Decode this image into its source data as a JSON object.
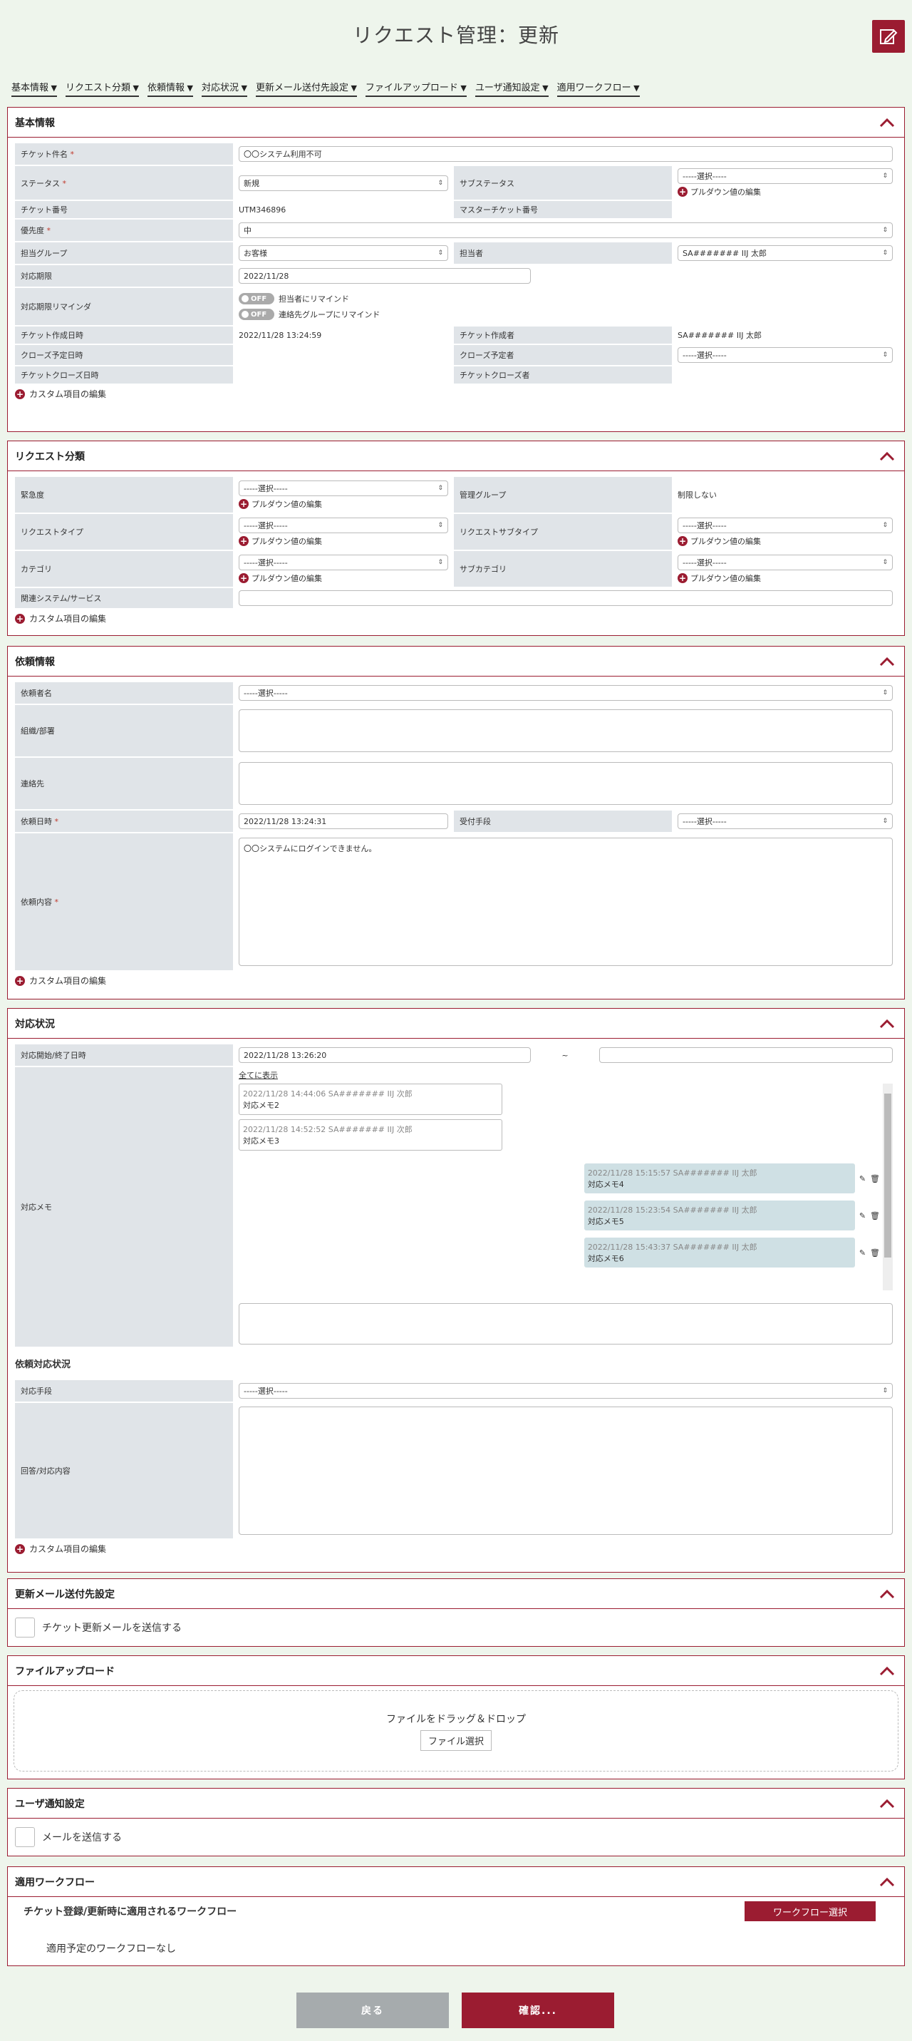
{
  "page_title": "リクエスト管理：更新",
  "anchors": [
    "基本情報",
    "リクエスト分類",
    "依頼情報",
    "対応状況",
    "更新メール送付先設定",
    "ファイルアップロード",
    "ユーザ通知設定",
    "適用ワークフロー"
  ],
  "custom_edit": "カスタム項目の編集",
  "pulldown_edit": "プルダウン値の編集",
  "basic": {
    "title": "基本情報",
    "ticket_name_label": "チケット件名",
    "ticket_name": "〇〇システム利用不可",
    "status_label": "ステータス",
    "status": "新規",
    "substatus_label": "サブステータス",
    "substatus": "-----選択-----",
    "ticket_no_label": "チケット番号",
    "ticket_no": "UTM346896",
    "master_label": "マスターチケット番号",
    "master": "",
    "priority_label": "優先度",
    "priority": "中",
    "group_label": "担当グループ",
    "group": "お客様",
    "assignee_label": "担当者",
    "assignee": "SA####### IIJ 太郎",
    "deadline_label": "対応期限",
    "deadline": "2022/11/28",
    "reminder_label": "対応期限リマインダ",
    "toggle_off": "OFF",
    "remind1": "担当者にリマインド",
    "remind2": "連絡先グループにリマインド",
    "created_label": "チケット作成日時",
    "created": "2022/11/28 13:24:59",
    "creator_label": "チケット作成者",
    "creator": "SA####### IIJ 太郎",
    "close_plan_label": "クローズ予定日時",
    "close_plan": "",
    "close_person_label": "クローズ予定者",
    "close_person": "-----選択-----",
    "closed_label": "チケットクローズ日時",
    "closed": "",
    "closer_label": "チケットクローズ者",
    "closer": ""
  },
  "category": {
    "title": "リクエスト分類",
    "urgency_label": "緊急度",
    "urgency": "-----選択-----",
    "mgmt_label": "管理グループ",
    "mgmt": "制限しない",
    "type_label": "リクエストタイプ",
    "type": "-----選択-----",
    "subtype_label": "リクエストサブタイプ",
    "subtype": "-----選択-----",
    "cat_label": "カテゴリ",
    "cat": "-----選択-----",
    "subcat_label": "サブカテゴリ",
    "subcat": "-----選択-----",
    "system_label": "関連システム/サービス",
    "system": ""
  },
  "request": {
    "title": "依頼情報",
    "requester_label": "依頼者名",
    "requester": "-----選択-----",
    "org_label": "組織/部署",
    "contact_label": "連絡先",
    "date_label": "依頼日時",
    "date": "2022/11/28 13:24:31",
    "method_label": "受付手段",
    "method": "-----選択-----",
    "content_label": "依頼内容",
    "content": "〇〇システムにログインできません。"
  },
  "progress": {
    "title": "対応状況",
    "period_label": "対応開始/終了日時",
    "start": "2022/11/28 13:26:20",
    "tilde": "~",
    "end": "",
    "memo_label": "対応メモ",
    "show_all": "全てに表示",
    "memos_left": [
      {
        "meta": "2022/11/28 14:44:06  SA####### IIJ 次郎",
        "text": "対応メモ2"
      },
      {
        "meta": "2022/11/28 14:52:52  SA####### IIJ 次郎",
        "text": "対応メモ3"
      }
    ],
    "memos_right": [
      {
        "meta": "2022/11/28 15:15:57  SA####### IIJ 太郎",
        "text": "対応メモ4"
      },
      {
        "meta": "2022/11/28 15:23:54  SA####### IIJ 太郎",
        "text": "対応メモ5"
      },
      {
        "meta": "2022/11/28 15:43:37  SA####### IIJ 太郎",
        "text": "対応メモ6"
      }
    ],
    "req_status_title": "依頼対応状況",
    "handling_label": "対応手段",
    "handling": "-----選択-----",
    "answer_label": "回答/対応内容"
  },
  "mail": {
    "title": "更新メール送付先設定",
    "check": "チケット更新メールを送信する"
  },
  "upload": {
    "title": "ファイルアップロード",
    "drop": "ファイルをドラッグ＆ドロップ",
    "btn": "ファイル選択"
  },
  "notify": {
    "title": "ユーザ通知設定",
    "check": "メールを送信する"
  },
  "workflow": {
    "title": "適用ワークフロー",
    "subtitle": "チケット登録/更新時に適用されるワークフロー",
    "btn": "ワークフロー選択",
    "none": "適用予定のワークフローなし"
  },
  "footer": {
    "back": "戻る",
    "confirm": "確認..."
  }
}
